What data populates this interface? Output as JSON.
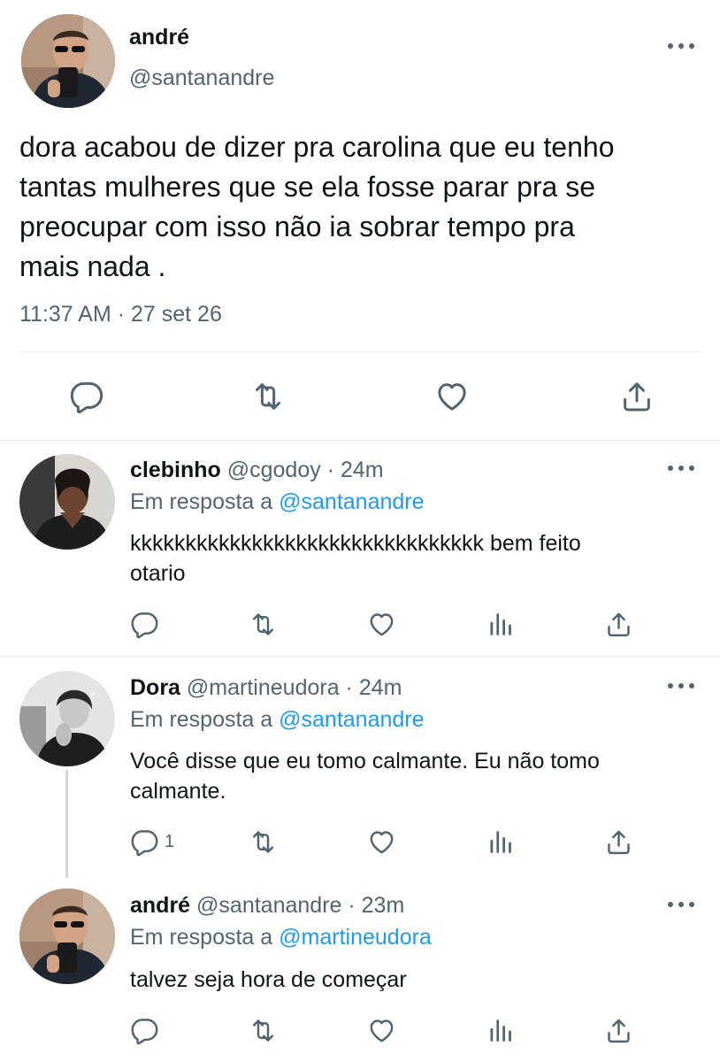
{
  "main_tweet": {
    "display_name": "andré",
    "handle": "@santanandre",
    "text_lines": [
      "dora acabou de dizer pra carolina que eu tenho",
      "tantas mulheres que se ela fosse parar pra se",
      "preocupar com isso não ia sobrar tempo pra",
      "mais nada ."
    ],
    "timestamp": "11:37 AM · 27 set 26"
  },
  "replies": [
    {
      "display_name": "clebinho",
      "meta": "@cgodoy · 24m",
      "reply_prefix": "Em resposta a",
      "reply_to": "@santanandre",
      "text_lines": [
        "kkkkkkkkkkkkkkkkkkkkkkkkkkkkkkkk bem feito",
        "otario"
      ],
      "reply_count": ""
    },
    {
      "display_name": "Dora",
      "meta": "@martineudora · 24m",
      "reply_prefix": "Em resposta a",
      "reply_to": "@santanandre",
      "text_lines": [
        "Você disse que eu tomo calmante. Eu não tomo",
        "calmante."
      ],
      "reply_count": "1"
    },
    {
      "display_name": "andré",
      "meta": "@santanandre · 23m",
      "reply_prefix": "Em resposta a",
      "reply_to": "@martineudora",
      "text_lines": [
        "talvez seja hora de começar"
      ],
      "reply_count": ""
    }
  ],
  "icons": {
    "reply": "reply-icon",
    "retweet": "retweet-icon",
    "like": "like-icon",
    "views": "views-icon",
    "share": "share-icon",
    "more": "more-icon"
  },
  "colors": {
    "text": "#0f1419",
    "secondary": "#536471",
    "link": "#1d9bf0",
    "divider": "#e7e9ea"
  }
}
